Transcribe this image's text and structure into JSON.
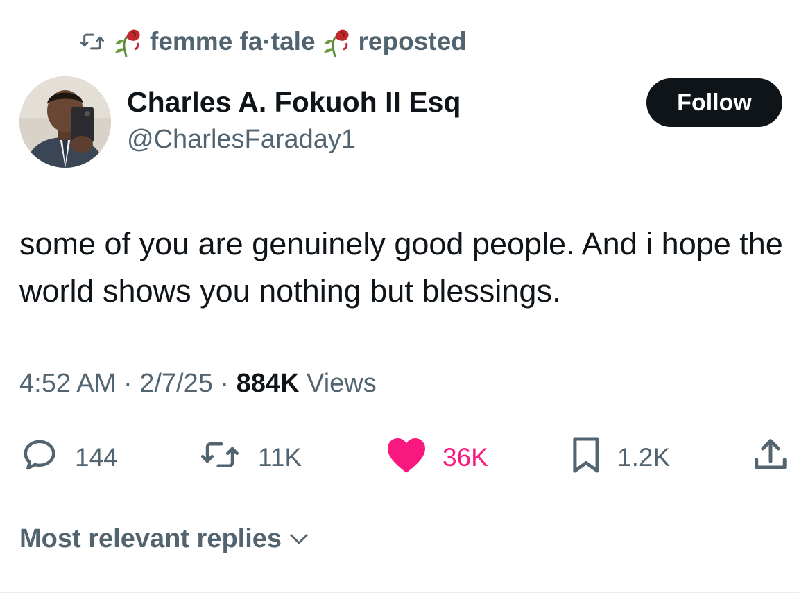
{
  "repost": {
    "user_name": "femme fa·tale",
    "suffix": "reposted"
  },
  "author": {
    "display_name": "Charles A. Fokuoh II Esq",
    "handle": "@CharlesFaraday1"
  },
  "follow_label": "Follow",
  "tweet": {
    "text": "some of you are genuinely good people. And i hope the world shows you nothing but blessings."
  },
  "meta": {
    "time": "4:52 AM",
    "separator": "·",
    "date": "2/7/25",
    "views_count": "884K",
    "views_label": "Views"
  },
  "actions": {
    "replies": "144",
    "reposts": "11K",
    "likes": "36K",
    "bookmarks": "1.2K"
  },
  "replies_sort_label": "Most relevant replies",
  "colors": {
    "text_primary": "#0f1419",
    "text_secondary": "#536471",
    "like": "#f91880",
    "follow_bg": "#0f1419"
  }
}
